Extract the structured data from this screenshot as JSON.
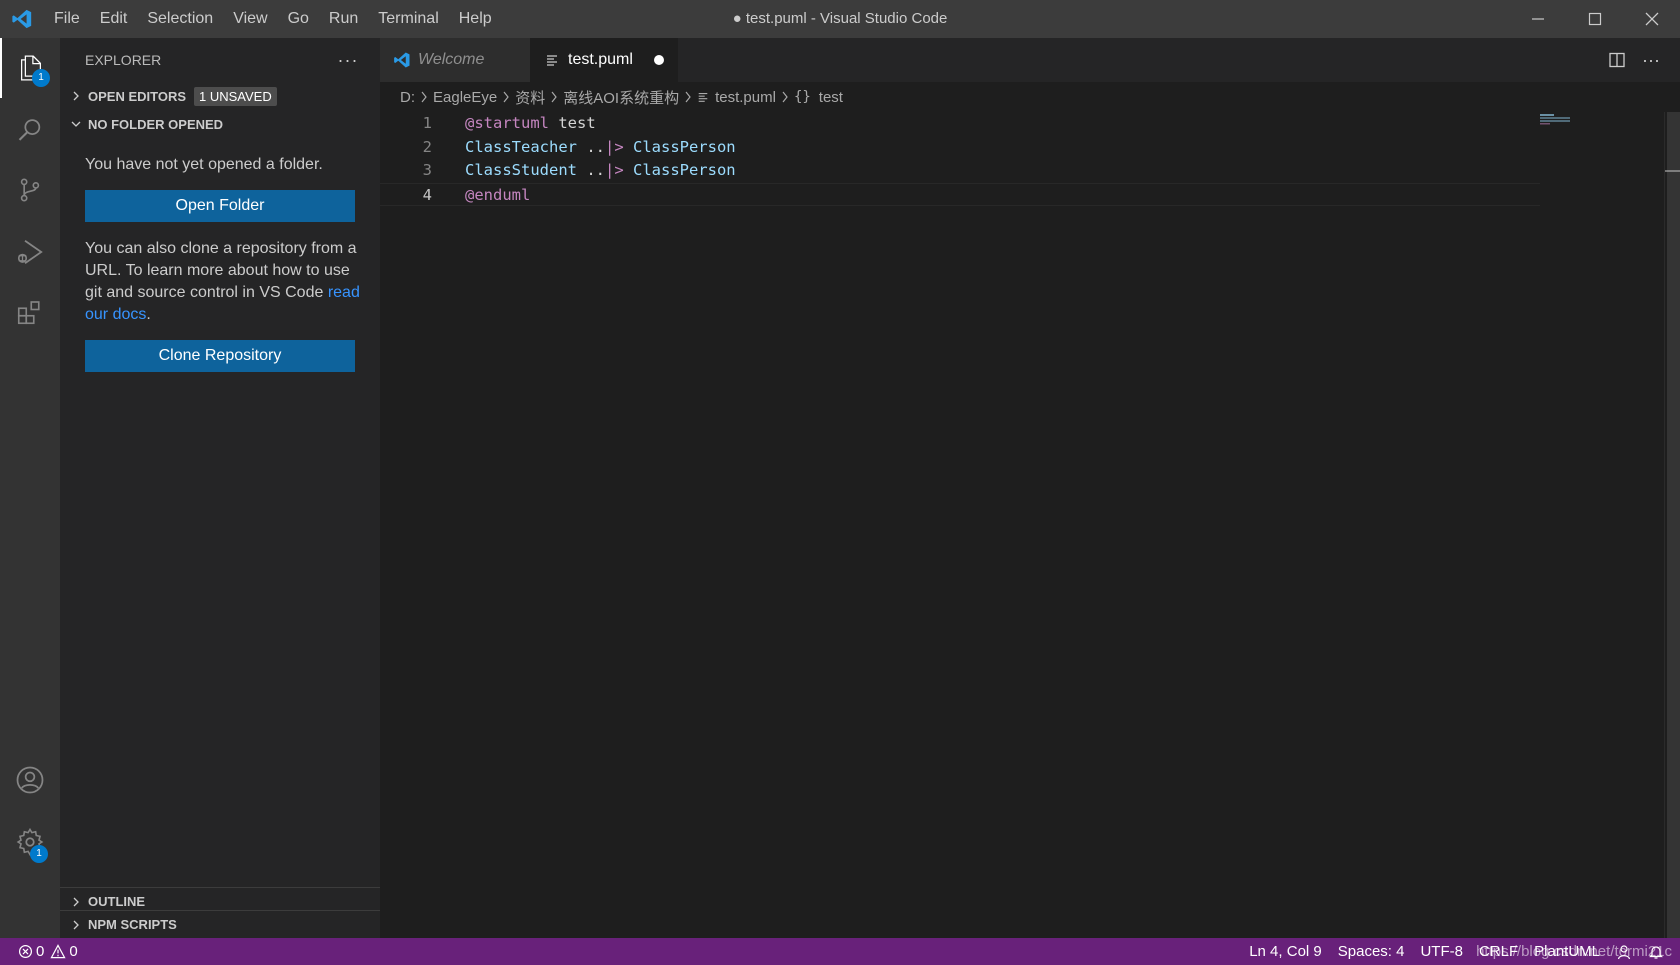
{
  "window": {
    "title": "● test.puml - Visual Studio Code"
  },
  "menu": [
    "File",
    "Edit",
    "Selection",
    "View",
    "Go",
    "Run",
    "Terminal",
    "Help"
  ],
  "activity": {
    "explorer_badge": "1",
    "settings_badge": "1"
  },
  "sidebar": {
    "title": "EXPLORER",
    "more": "···",
    "open_editors": "OPEN EDITORS",
    "unsaved_badge": "1 UNSAVED",
    "no_folder": "NO FOLDER OPENED",
    "no_folder_msg": "You have not yet opened a folder.",
    "open_folder_button": "Open Folder",
    "clone_msg": "You can also clone a repository from a URL. To learn more about how to use git and source control in VS Code ",
    "docs_link": "read our docs",
    "clone_msg_end": ".",
    "clone_button": "Clone Repository",
    "outline": "OUTLINE",
    "npm_scripts": "NPM SCRIPTS"
  },
  "tabs": [
    {
      "label": "Welcome",
      "active": false
    },
    {
      "label": "test.puml",
      "active": true,
      "dirty": true
    }
  ],
  "breadcrumbs": [
    "D:",
    "EagleEye",
    "资料",
    "离线AOI系统重构",
    "test.puml",
    "test"
  ],
  "code": {
    "lines": [
      {
        "num": "1",
        "tokens": [
          {
            "t": "@startuml",
            "c": "kw"
          },
          {
            "t": " test",
            "c": "plain"
          }
        ]
      },
      {
        "num": "2",
        "tokens": [
          {
            "t": "ClassTeacher",
            "c": "id"
          },
          {
            "t": " ..",
            "c": "plain"
          },
          {
            "t": "|>",
            "c": "kw"
          },
          {
            "t": " ClassPerson",
            "c": "id"
          }
        ]
      },
      {
        "num": "3",
        "tokens": [
          {
            "t": "ClassStudent",
            "c": "id"
          },
          {
            "t": " ..",
            "c": "plain"
          },
          {
            "t": "|>",
            "c": "kw"
          },
          {
            "t": " ClassPerson",
            "c": "id"
          }
        ]
      },
      {
        "num": "4",
        "tokens": [
          {
            "t": "@enduml",
            "c": "kw"
          }
        ]
      }
    ],
    "current_line": 4
  },
  "status": {
    "errors": "0",
    "warnings": "0",
    "position": "Ln 4, Col 9",
    "spaces": "Spaces: 4",
    "encoding": "UTF-8",
    "eol": "CRLF",
    "language": "PlantUML",
    "watermark": "https://blog.csdn.net/tormi21c"
  },
  "colors": {
    "statusbar": "#68217a",
    "button": "#0e639c",
    "accent": "#007acc"
  }
}
